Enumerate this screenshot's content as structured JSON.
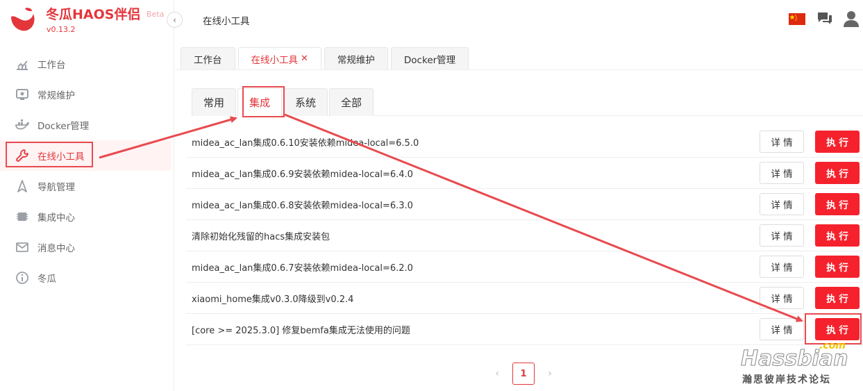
{
  "app": {
    "title": "冬瓜HAOS伴侣",
    "badge": "Beta",
    "version": "v0.13.2"
  },
  "sidebar": {
    "items": [
      {
        "label": "工作台",
        "icon": "chart-icon",
        "active": false
      },
      {
        "label": "常规维护",
        "icon": "maintenance-icon",
        "active": false
      },
      {
        "label": "Docker管理",
        "icon": "docker-icon",
        "active": false
      },
      {
        "label": "在线小工具",
        "icon": "wrench-icon",
        "active": true
      },
      {
        "label": "导航管理",
        "icon": "navigation-icon",
        "active": false
      },
      {
        "label": "集成中心",
        "icon": "chip-icon",
        "active": false
      },
      {
        "label": "消息中心",
        "icon": "mail-icon",
        "active": false
      },
      {
        "label": "冬瓜",
        "icon": "info-icon",
        "active": false
      }
    ]
  },
  "header": {
    "breadcrumb": "在线小工具"
  },
  "tabs": [
    {
      "label": "工作台",
      "active": false,
      "closable": false
    },
    {
      "label": "在线小工具",
      "active": true,
      "closable": true
    },
    {
      "label": "常规维护",
      "active": false,
      "closable": false
    },
    {
      "label": "Docker管理",
      "active": false,
      "closable": false
    }
  ],
  "subtabs": [
    {
      "label": "常用",
      "active": false
    },
    {
      "label": "集成",
      "active": true
    },
    {
      "label": "系统",
      "active": false
    },
    {
      "label": "全部",
      "active": false
    }
  ],
  "buttons": {
    "detail": "详 情",
    "execute": "执 行"
  },
  "tools": [
    "midea_ac_lan集成0.6.10安装依赖midea-local=6.5.0",
    "midea_ac_lan集成0.6.9安装依赖midea-local=6.4.0",
    "midea_ac_lan集成0.6.8安装依赖midea-local=6.3.0",
    "清除初始化残留的hacs集成安装包",
    "midea_ac_lan集成0.6.7安装依赖midea-local=6.2.0",
    "xiaomi_home集成v0.3.0降级到v0.2.4",
    "[core >= 2025.3.0] 修复bemfa集成无法使用的问题"
  ],
  "pagination": {
    "current": "1"
  },
  "watermark": {
    "brand": "Hassbian",
    "suffix": ".com",
    "subtitle": "瀚思彼岸技术论坛"
  },
  "colors": {
    "accent": "#e3363b",
    "execute": "#f5222d",
    "annotation": "#e84a4f"
  }
}
